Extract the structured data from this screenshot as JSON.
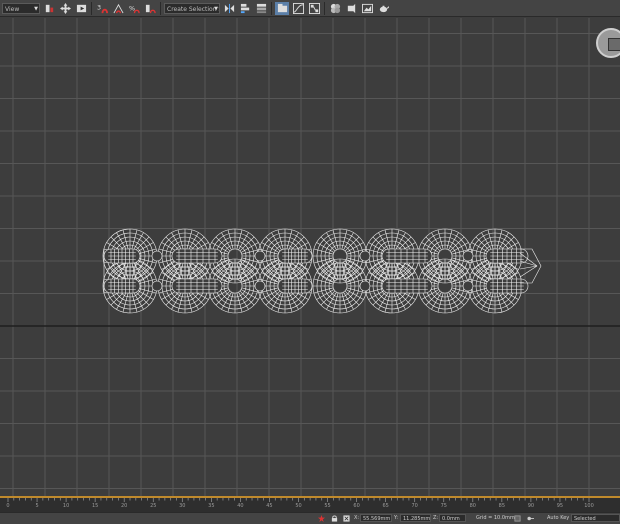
{
  "toolbar": {
    "ref_coord_dropdown": "View",
    "selection_set_dropdown": "Create Selection S..."
  },
  "viewport": {
    "grid_color": "#575757",
    "grid_major_color": "#1e1e1e",
    "wire_color": "#f2f2f2",
    "background": "#3d3d3d"
  },
  "timeline": {
    "ticks": [
      "0",
      "5",
      "10",
      "15",
      "20",
      "25",
      "30",
      "35",
      "40",
      "45",
      "50",
      "55",
      "60",
      "65",
      "70",
      "75",
      "80",
      "85",
      "90",
      "95",
      "100"
    ]
  },
  "statusbar": {
    "x_label": "X:",
    "x_value": "55.569mm",
    "y_label": "Y:",
    "y_value": "11.285mm",
    "z_label": "Z:",
    "z_value": "0.0mm",
    "grid_text": "Grid = 10.0mm",
    "autokey_label": "Auto Key",
    "autokey_value": "Selected"
  }
}
